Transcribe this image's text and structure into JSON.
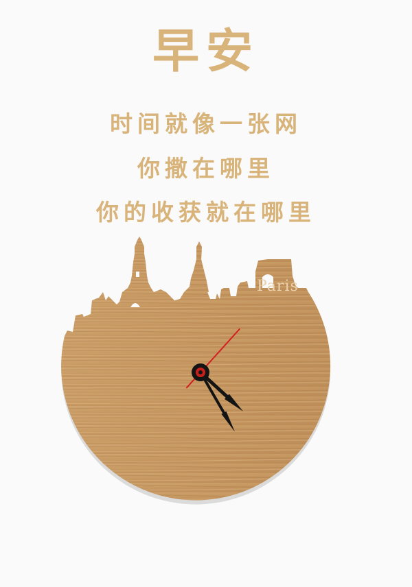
{
  "greeting": {
    "title": "早安",
    "lines": [
      "时间就像一张网",
      "你撒在哪里",
      "你的收获就在哪里"
    ]
  },
  "clock": {
    "skyline_label": "Paris",
    "time": {
      "hour": 4,
      "minute": 25,
      "second": 7
    }
  },
  "colors": {
    "text": "#d8b37a",
    "wood": "#c99a63",
    "wood_dark": "#a97944",
    "hands": "#141414",
    "second_hand": "#d42020",
    "background": "#fafafa"
  }
}
